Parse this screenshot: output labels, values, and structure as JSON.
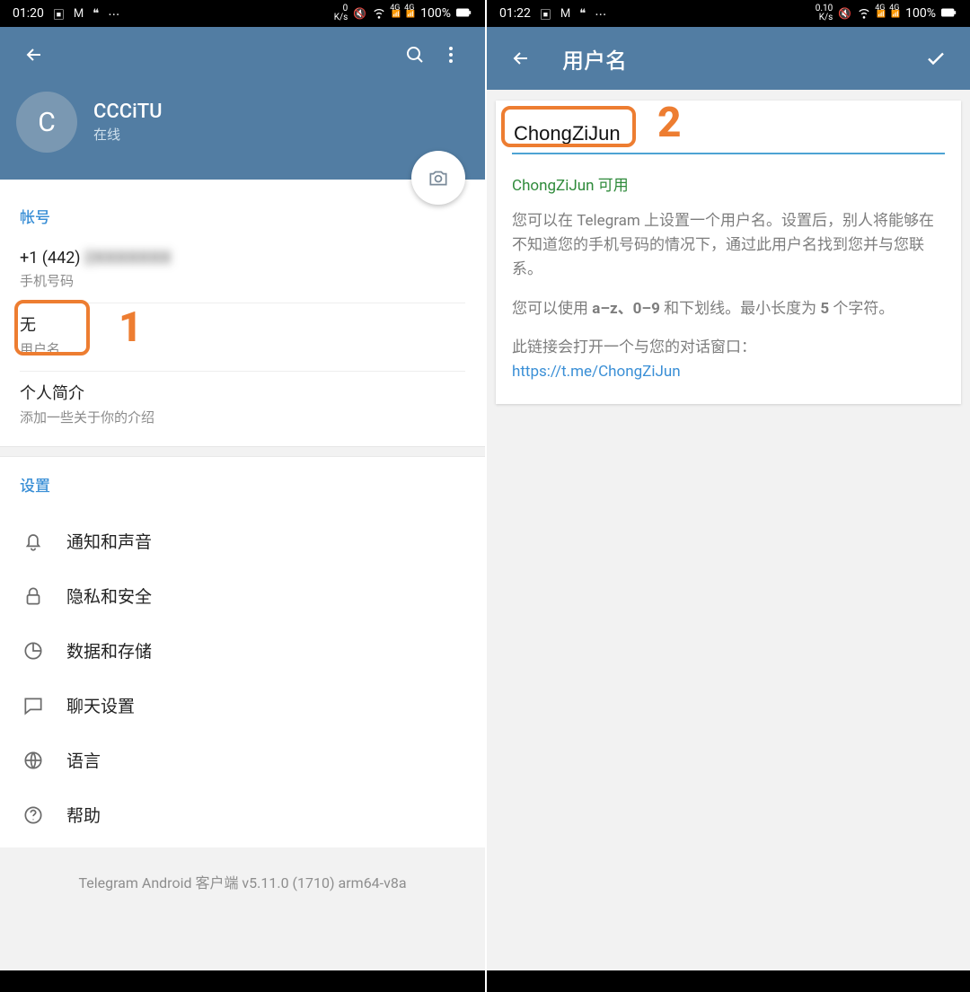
{
  "left": {
    "status": {
      "time": "01:20",
      "speed": "0\nK/s",
      "net": "4G",
      "battery": "100%"
    },
    "profile": {
      "avatar_initial": "C",
      "name": "CCCiTU",
      "status": "在线"
    },
    "account": {
      "header": "帐号",
      "phone_prefix": "+1 (442) ",
      "phone_hidden": "2XXXXXXX",
      "phone_label": "手机号码",
      "username_value": "无",
      "username_label": "用户名",
      "bio_title": "个人简介",
      "bio_hint": "添加一些关于你的介绍"
    },
    "settings": {
      "header": "设置",
      "items": [
        "通知和声音",
        "隐私和安全",
        "数据和存储",
        "聊天设置",
        "语言",
        "帮助"
      ]
    },
    "version": "Telegram Android 客户端 v5.11.0 (1710) arm64-v8a",
    "annotation_num": "1"
  },
  "right": {
    "status": {
      "time": "01:22",
      "speed": "0.10\nK/s",
      "net": "4G",
      "battery": "100%"
    },
    "appbar_title": "用户名",
    "username_input": "ChongZiJun",
    "available_text": "ChongZiJun 可用",
    "desc1": "您可以在 Telegram 上设置一个用户名。设置后，别人将能够在不知道您的手机号码的情况下，通过此用户名找到您并与您联系。",
    "desc2_prefix": "您可以使用 ",
    "desc2_bold1": "a–z、0–9",
    "desc2_mid": " 和下划线。最小长度为 ",
    "desc2_bold2": "5",
    "desc2_suffix": " 个字符。",
    "desc3": "此链接会打开一个与您的对话窗口：",
    "link": "https://t.me/ChongZiJun",
    "annotation_num": "2"
  }
}
